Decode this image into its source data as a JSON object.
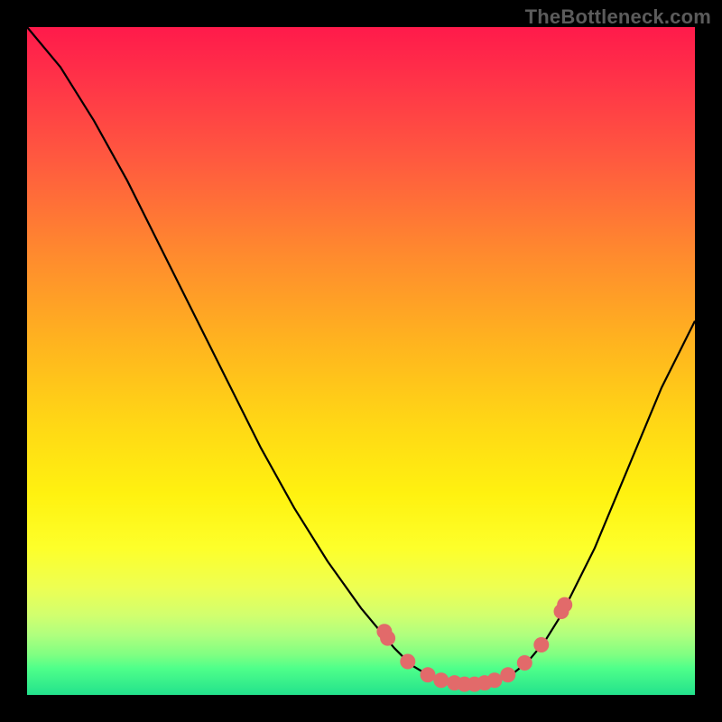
{
  "watermark": "TheBottleneck.com",
  "colors": {
    "background": "#000000",
    "curve_stroke": "#000000",
    "marker_fill": "#e26a6a",
    "marker_stroke": "#c94f4f"
  },
  "chart_data": {
    "type": "line",
    "title": "",
    "xlabel": "",
    "ylabel": "",
    "xlim": [
      0,
      1
    ],
    "ylim": [
      0,
      1
    ],
    "x": [
      0.0,
      0.05,
      0.1,
      0.15,
      0.2,
      0.25,
      0.3,
      0.35,
      0.4,
      0.45,
      0.5,
      0.55,
      0.575,
      0.6,
      0.625,
      0.65,
      0.675,
      0.7,
      0.725,
      0.75,
      0.775,
      0.8,
      0.85,
      0.9,
      0.95,
      1.0
    ],
    "values": [
      1.0,
      0.94,
      0.86,
      0.77,
      0.67,
      0.57,
      0.47,
      0.37,
      0.28,
      0.2,
      0.13,
      0.07,
      0.045,
      0.03,
      0.02,
      0.015,
      0.015,
      0.02,
      0.03,
      0.05,
      0.08,
      0.12,
      0.22,
      0.34,
      0.46,
      0.56
    ],
    "markers": {
      "x": [
        0.535,
        0.54,
        0.57,
        0.6,
        0.62,
        0.64,
        0.655,
        0.67,
        0.685,
        0.7,
        0.72,
        0.745,
        0.77,
        0.8,
        0.805
      ],
      "y": [
        0.095,
        0.085,
        0.05,
        0.03,
        0.022,
        0.018,
        0.016,
        0.016,
        0.018,
        0.022,
        0.03,
        0.048,
        0.075,
        0.125,
        0.135
      ]
    }
  }
}
